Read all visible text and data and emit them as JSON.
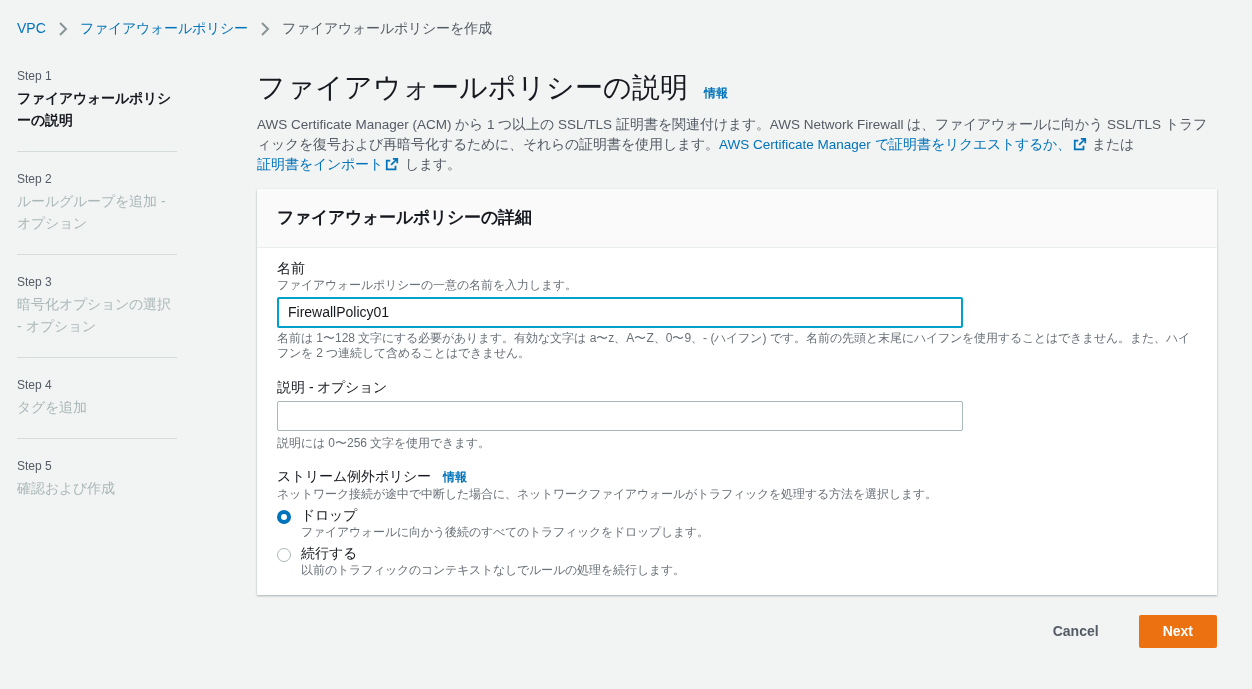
{
  "breadcrumb": [
    {
      "label": "VPC",
      "link": true
    },
    {
      "label": "ファイアウォールポリシー",
      "link": true
    },
    {
      "label": "ファイアウォールポリシーを作成",
      "link": false
    }
  ],
  "steps": [
    {
      "step": "Step 1",
      "label": "ファイアウォールポリシーの説明",
      "selected": true
    },
    {
      "step": "Step 2",
      "label": "ルールグループを追加 - オプション",
      "selected": false
    },
    {
      "step": "Step 3",
      "label": "暗号化オプションの選択 - オプション",
      "selected": false
    },
    {
      "step": "Step 4",
      "label": "タグを追加",
      "selected": false
    },
    {
      "step": "Step 5",
      "label": "確認および作成",
      "selected": false
    }
  ],
  "page": {
    "title": "ファイアウォールポリシーの説明",
    "info": "情報",
    "description": [
      {
        "text": "AWS Certificate Manager (ACM) から 1 つ以上の SSL/TLS 証明書を関連付けます。AWS Network Firewall は、ファイアウォールに向かう SSL/TLS トラフィックを復号および再暗号化するために、それらの証明書を使用します。",
        "kind": "text"
      },
      {
        "text": "AWS Certificate Manager で証明書をリクエストするか、",
        "kind": "link"
      },
      {
        "kind": "external"
      },
      {
        "text": " または ",
        "kind": "text"
      },
      {
        "text": "証明書をインポート",
        "kind": "link"
      },
      {
        "kind": "external"
      },
      {
        "text": " します。",
        "kind": "text"
      }
    ]
  },
  "card": {
    "title": "ファイアウォールポリシーの詳細",
    "name": {
      "label": "名前",
      "hint": "ファイアウォールポリシーの一意の名前を入力します。",
      "value": "FirewallPolicy01",
      "constraint": "名前は 1〜128 文字にする必要があります。有効な文字は a〜z、A〜Z、0〜9、- (ハイフン) です。名前の先頭と末尾にハイフンを使用することはできません。また、ハイフンを 2 つ連続して含めることはできません。"
    },
    "description": {
      "label": "説明 - オプション",
      "constraint": "説明には 0〜256 文字を使用できます。"
    },
    "stream": {
      "label": "ストリーム例外ポリシー",
      "info": "情報",
      "hint": "ネットワーク接続が途中で中断した場合に、ネットワークファイアウォールがトラフィックを処理する方法を選択します。",
      "options": [
        {
          "label": "ドロップ",
          "hint": "ファイアウォールに向かう後続のすべてのトラフィックをドロップします。",
          "selected": true
        },
        {
          "label": "続行する",
          "hint": "以前のトラフィックのコンテキストなしでルールの処理を続行します。",
          "selected": false
        }
      ]
    }
  },
  "buttons": {
    "cancel": "Cancel",
    "next": "Next"
  }
}
